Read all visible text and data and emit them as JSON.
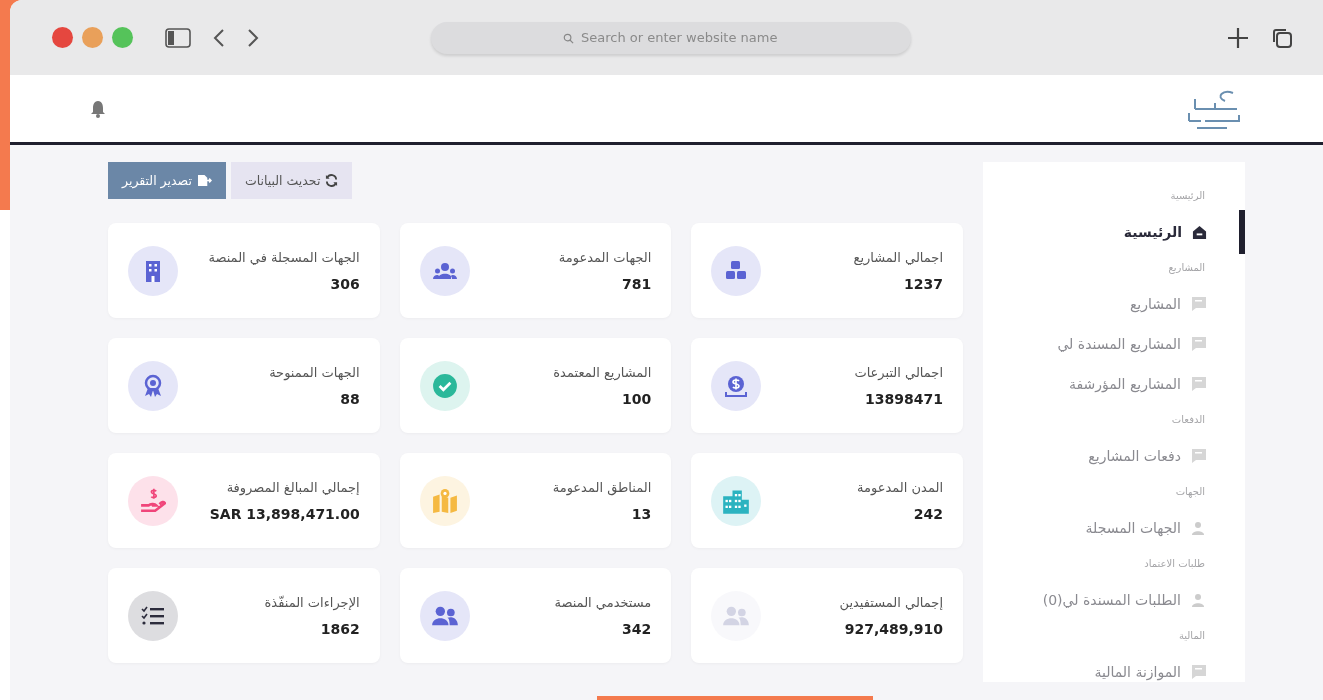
{
  "browser": {
    "address_placeholder": "Search or enter website name"
  },
  "toolbar": {
    "buttons": [
      {
        "label": "تحديث البيانات",
        "kind": "refresh"
      },
      {
        "label": "تصدير التقرير",
        "kind": "export"
      }
    ]
  },
  "stats": [
    {
      "label": "اجمالي المشاريع",
      "value": "1237",
      "kind": "cubes",
      "color": "#5b63d3"
    },
    {
      "label": "الجهات المدعومة",
      "value": "781",
      "kind": "group",
      "color": "#5b63d3"
    },
    {
      "label": "الجهات المسجلة في المنصة",
      "value": "306",
      "kind": "building",
      "color": "#5b63d3"
    },
    {
      "label": "اجمالي التبرعات",
      "value": "13898471",
      "kind": "coin",
      "color": "#5b63d3"
    },
    {
      "label": "المشاريع المعتمدة",
      "value": "100",
      "kind": "check",
      "color": "#2bb89a"
    },
    {
      "label": "الجهات الممنوحة",
      "value": "88",
      "kind": "award",
      "color": "#5b63d3"
    },
    {
      "label": "المدن المدعومة",
      "value": "242",
      "kind": "city",
      "color": "#2bb3c0"
    },
    {
      "label": "المناطق المدعومة",
      "value": "13",
      "kind": "map",
      "color": "#f5b942"
    },
    {
      "label": "إجمالي المبالغ المصروفة",
      "value": "SAR 13,898,471.00",
      "kind": "hand",
      "color": "#f0457a"
    },
    {
      "label": "إجمالي المستفيدين",
      "value": "927,489,910",
      "kind": "users",
      "color": "#d3d4e4"
    },
    {
      "label": "مستخدمي المنصة",
      "value": "342",
      "kind": "users",
      "color": "#5b63d3"
    },
    {
      "label": "الإجراءات المنفّذة",
      "value": "1862",
      "kind": "list",
      "color": "#2c2c3c"
    }
  ],
  "sidebar": {
    "sections": [
      {
        "label": "الرئيسية",
        "items": [
          {
            "label": "الرئيسية",
            "kind": "home",
            "selected": true
          }
        ]
      },
      {
        "label": "المشاريع",
        "items": [
          {
            "label": "المشاريع",
            "kind": "chat",
            "selected": false
          },
          {
            "label": "المشاريع المسندة لي",
            "kind": "chat",
            "selected": false
          },
          {
            "label": "المشاريع المؤرشفة",
            "kind": "chat",
            "selected": false
          }
        ]
      },
      {
        "label": "الدفعات",
        "items": [
          {
            "label": "دفعات المشاريع",
            "kind": "chat",
            "selected": false
          }
        ]
      },
      {
        "label": "الجهات",
        "items": [
          {
            "label": "الجهات المسجلة",
            "kind": "user",
            "selected": false
          }
        ]
      },
      {
        "label": "طلبات الاعتماد",
        "items": [
          {
            "label": "الطلبات المسندة لي(0)",
            "kind": "user",
            "selected": false
          }
        ]
      },
      {
        "label": "المالية",
        "items": [
          {
            "label": "الموازنة المالية",
            "kind": "chat",
            "selected": false
          }
        ]
      }
    ]
  }
}
